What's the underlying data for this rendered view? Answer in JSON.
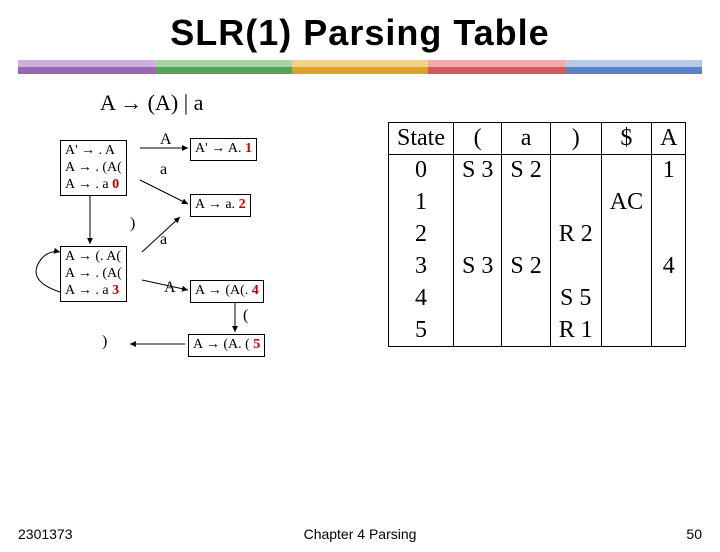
{
  "title": "SLR(1) Parsing Table",
  "grammar": "A → (A) | a",
  "colors": [
    {
      "top": "#cdb0d9",
      "bot": "#9966b3"
    },
    {
      "top": "#a9d4a8",
      "bot": "#58a257"
    },
    {
      "top": "#f1d28b",
      "bot": "#d9a12d"
    },
    {
      "top": "#f2abab",
      "bot": "#d15a5a"
    },
    {
      "top": "#b6c9e6",
      "bot": "#5b82c4"
    }
  ],
  "states": [
    {
      "id": "0",
      "lines": [
        "A' → . A",
        "A → . (A(",
        "A → . a"
      ]
    },
    {
      "id": "1",
      "lines": [
        "A' → A."
      ]
    },
    {
      "id": "2",
      "lines": [
        "A → a."
      ]
    },
    {
      "id": "3",
      "lines": [
        "A → (. A(",
        "A → . (A(",
        "A → . a"
      ]
    },
    {
      "id": "4",
      "lines": [
        "A → (A(."
      ]
    },
    {
      "id": "5",
      "lines": [
        "A → (A. ("
      ]
    }
  ],
  "edges": {
    "A": "A",
    "a": "a",
    "lp": "(",
    "rp": ")"
  },
  "table": {
    "header": [
      "State",
      "(",
      "a",
      ")",
      "$",
      "A"
    ],
    "rows": [
      [
        "0",
        "S 3",
        "S 2",
        "",
        "",
        "1"
      ],
      [
        "1",
        "",
        "",
        "",
        "AC",
        ""
      ],
      [
        "2",
        "",
        "",
        "R 2",
        "",
        ""
      ],
      [
        "3",
        "S 3",
        "S 2",
        "",
        "",
        "4"
      ],
      [
        "4",
        "",
        "",
        "S 5",
        "",
        ""
      ],
      [
        "5",
        "",
        "",
        "R 1",
        "",
        ""
      ]
    ]
  },
  "footer": {
    "left": "2301373",
    "center": "Chapter 4  Parsing",
    "right": "50"
  },
  "chart_data": {
    "type": "table",
    "title": "SLR(1) Parsing Table",
    "columns": [
      "State",
      "(",
      "a",
      ")",
      "$",
      "A"
    ],
    "rows": [
      {
        "State": 0,
        "(": "S3",
        "a": "S2",
        ")": "",
        "$": "",
        "A": "1"
      },
      {
        "State": 1,
        "(": "",
        "a": "",
        ")": "",
        "$": "AC",
        "A": ""
      },
      {
        "State": 2,
        "(": "",
        "a": "",
        ")": "R2",
        "$": "",
        "A": ""
      },
      {
        "State": 3,
        "(": "S3",
        "a": "S2",
        ")": "",
        "$": "",
        "A": "4"
      },
      {
        "State": 4,
        "(": "",
        "a": "",
        ")": "S5",
        "$": "",
        "A": ""
      },
      {
        "State": 5,
        "(": "",
        "a": "",
        ")": "R1",
        "$": "",
        "A": ""
      }
    ]
  }
}
